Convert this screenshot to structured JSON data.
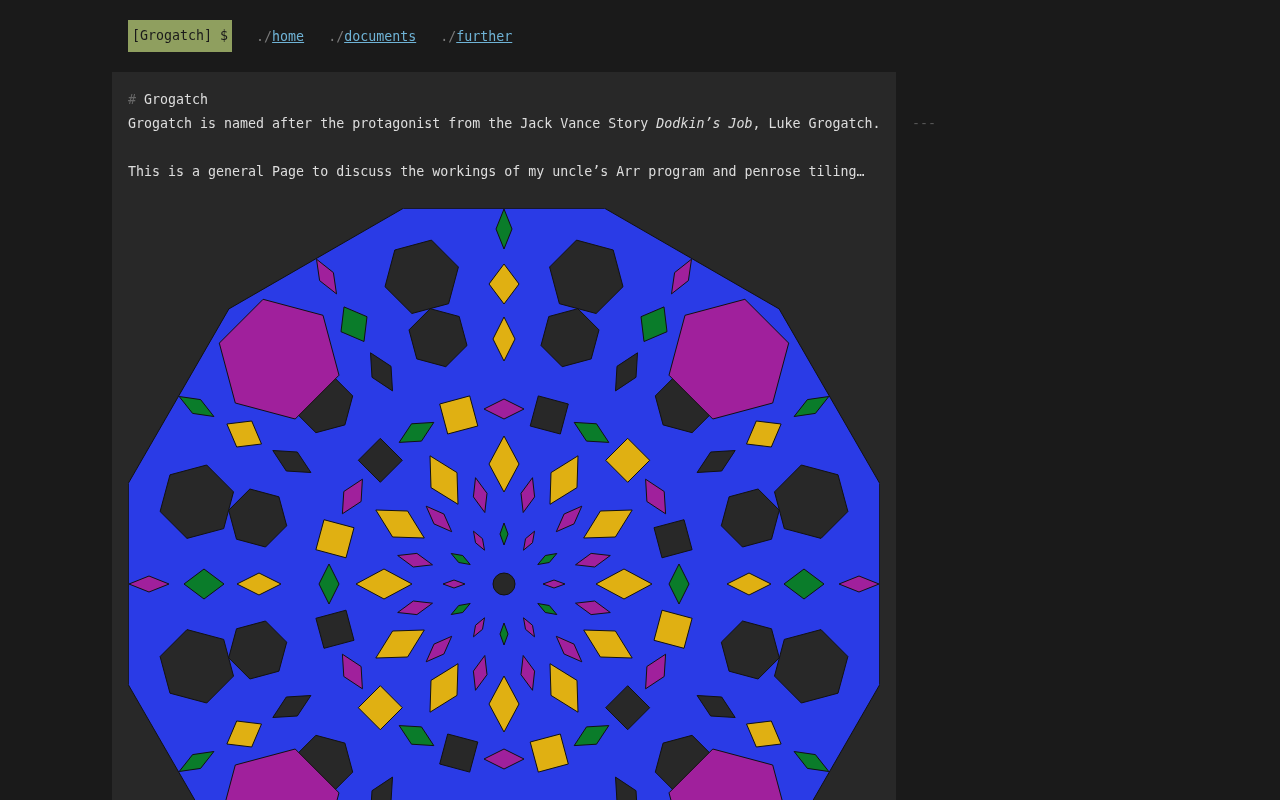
{
  "nav": {
    "prompt": "[Grogatch] $",
    "links": [
      {
        "prefix": "./",
        "label": "home"
      },
      {
        "prefix": "./",
        "label": "documents"
      },
      {
        "prefix": "./",
        "label": "further"
      }
    ]
  },
  "article": {
    "heading_marker": "#",
    "heading": "Grogatch",
    "paragraphs": [
      "Grogatch is named after the protagonist from the Jack Vance Story *Dodkin’s Job*, Luke Grogatch.",
      "This is a general Page to discuss the workings of my uncle’s Arr program and penrose tiling…"
    ],
    "figure": {
      "kind": "tiling"
    }
  },
  "aside": {
    "rule": "---"
  }
}
